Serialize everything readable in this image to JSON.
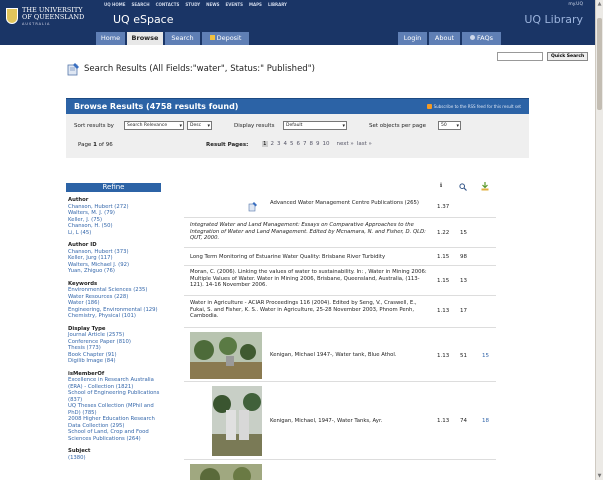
{
  "header": {
    "logo_line1": "THE UNIVERSITY",
    "logo_line2": "OF QUEENSLAND",
    "logo_sub": "AUSTRALIA",
    "top_links": [
      "UQ HOME",
      "SEARCH",
      "CONTACTS",
      "STUDY",
      "NEWS",
      "EVENTS",
      "MAPS",
      "LIBRARY"
    ],
    "uq_id": "my.UQ",
    "site_title": "UQ eSpace",
    "library_title": "UQ Library"
  },
  "nav": {
    "tabs": [
      "Home",
      "Browse",
      "Search",
      "Deposit"
    ],
    "right_tabs": [
      "Login",
      "About",
      "FAQs"
    ]
  },
  "search": {
    "button": "Quick Search"
  },
  "results": {
    "heading": "Search Results (All Fields:\"water\", Status:\" Published\")",
    "bar_title": "Browse Results (4758 results found)",
    "rss": "Subscribe to the RSS feed for this result set"
  },
  "controls": {
    "sort_label": "Sort results by",
    "sort_value": "Search Relevance",
    "order_value": "Desc",
    "display_label": "Display results",
    "display_value": "Default",
    "perpage_label": "Set objects per page",
    "perpage_value": "50",
    "page_prefix": "Page",
    "page_num": "1",
    "page_of": "of 96",
    "pages_label": "Result Pages:",
    "pages": [
      "1",
      "2",
      "3",
      "4",
      "5",
      "6",
      "7",
      "8",
      "9",
      "10"
    ],
    "next": "next »",
    "last": "last »"
  },
  "refine": {
    "title": "Refine"
  },
  "facets": [
    {
      "title": "Author",
      "items": [
        "Chanson, Hubert (272)",
        "Walters, M. J. (79)",
        "Keller, J. (75)",
        "Chanson, H. (50)",
        "Li, L (45)"
      ]
    },
    {
      "title": "Author ID",
      "items": [
        "Chanson, Hubert (373)",
        "Keller, Jurg (117)",
        "Walters, Michael J. (92)",
        "Yuan, Zhiguo (76)"
      ]
    },
    {
      "title": "Keywords",
      "items": [
        "Environmental Sciences (235)",
        "Water Resources (228)",
        "Water (186)",
        "Engineering, Environmental (129)",
        "Chemistry, Physical (101)"
      ]
    },
    {
      "title": "Display Type",
      "items": [
        "Journal Article (2575)",
        "Conference Paper (810)",
        "Thesis (773)",
        "Book Chapter (91)",
        "Digilib Image (84)"
      ]
    },
    {
      "title": "isMemberOf",
      "items": [
        "Excellence in Research Australia (ERA) - Collection (1821)",
        "School of Engineering Publications (837)",
        "UQ Theses Collection (MPhil and PhD) (785)",
        "2008 Higher Education Research Data Collection (295)",
        "School of Land, Crop and Food Sciences Publications (264)"
      ]
    },
    {
      "title": "Subject",
      "items": [
        "(1380)"
      ]
    }
  ],
  "table_icons": [
    "info-icon",
    "magnifier-icon",
    "download-icon"
  ],
  "rows": [
    {
      "text": "Advanced Water Management Centre Publications (265)",
      "m1": "1.37",
      "m2": "",
      "m3": ""
    },
    {
      "text": "Integrated Water and Land Management: Essays on Comparative Approaches to the Integration of Water and Land Management. Edited by Mcnamara, N. and Fisher, D. QLD: QUT, 2000.",
      "m1": "1.22",
      "m2": "15",
      "m3": ""
    },
    {
      "text": "Long Term Monitoring of Estuarine Water Quality: Brisbane River Turbidity",
      "m1": "1.15",
      "m2": "98",
      "m3": ""
    },
    {
      "text": "Moran, C. (2006). Linking the values of water to sustainability. In: , Water in Mining 2006: Multiple Values of Water. Water in Mining 2006, Brisbane, Queensland, Australia, (113-121). 14-16 November 2006.",
      "m1": "1.15",
      "m2": "13",
      "m3": ""
    },
    {
      "text": "Water in Agriculture - ACIAR Proceedings 116 (2004). Edited by Seng, V., Craswell, E., Fukai, S. and Fisher, K. S.. Water in Agriculture, 25-28 November 2003, Phnom Penh, Cambodia.",
      "m1": "1.13",
      "m2": "17",
      "m3": ""
    },
    {
      "text": "Kenigan, Michael 1947-, Water tank, Blue Athol.",
      "m1": "1.13",
      "m2": "51",
      "m3": "15"
    },
    {
      "text": "Kenigan, Michael, 1947-, Water Tanks, Ayr.",
      "m1": "1.13",
      "m2": "74",
      "m3": "18"
    },
    {
      "text": "",
      "m1": "",
      "m2": "",
      "m3": ""
    }
  ]
}
